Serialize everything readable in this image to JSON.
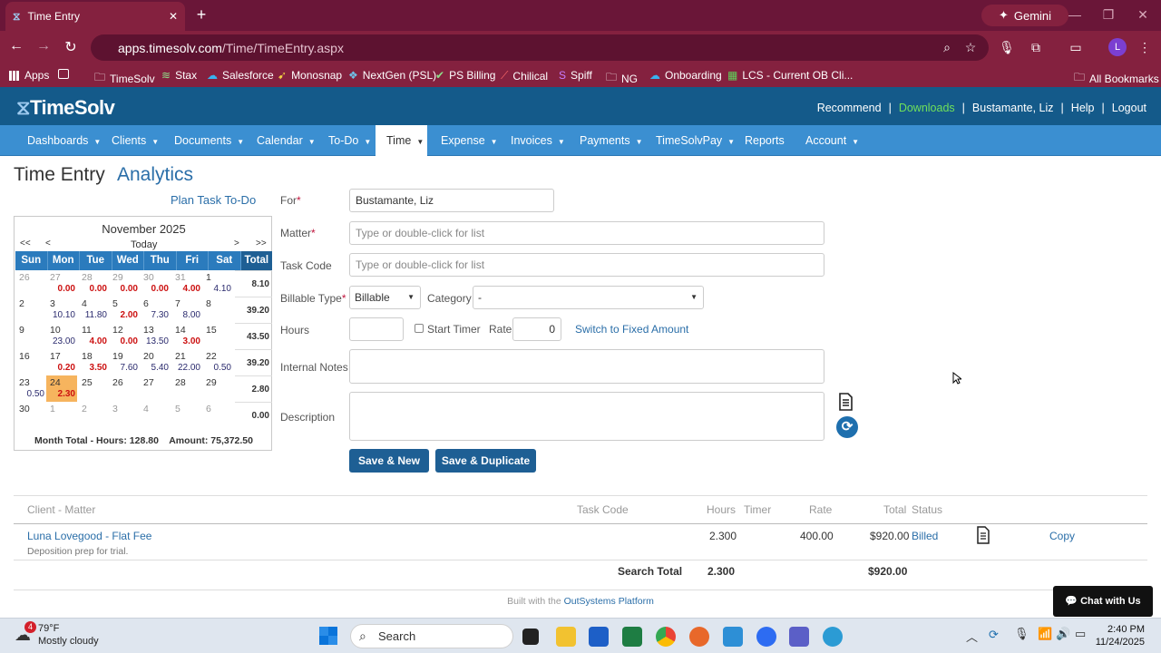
{
  "browser": {
    "tab_title": "Time Entry",
    "gemini_label": "Gemini",
    "url_host": "apps.timesolv.com",
    "url_path": "/Time/TimeEntry.aspx",
    "bookmarks": [
      "Apps",
      "TimeSolv",
      "Stax",
      "Salesforce",
      "Monosnap",
      "NextGen (PSL)",
      "PS Billing",
      "Chilical",
      "Spiff",
      "NG",
      "Onboarding",
      "LCS - Current OB Cli..."
    ],
    "all_bookmarks": "All Bookmarks",
    "avatar_letter": "L"
  },
  "app": {
    "logo": "TimeSolv",
    "top_links": {
      "recommend": "Recommend",
      "downloads": "Downloads",
      "user": "Bustamante, Liz",
      "help": "Help",
      "logout": "Logout"
    },
    "nav": [
      {
        "label": "Dashboards",
        "dropdown": true
      },
      {
        "label": "Clients",
        "dropdown": true
      },
      {
        "label": "Documents",
        "dropdown": true
      },
      {
        "label": "Calendar",
        "dropdown": true
      },
      {
        "label": "To-Do",
        "dropdown": true
      },
      {
        "label": "Time",
        "dropdown": true,
        "active": true
      },
      {
        "label": "Expense",
        "dropdown": true
      },
      {
        "label": "Invoices",
        "dropdown": true
      },
      {
        "label": "Payments",
        "dropdown": true
      },
      {
        "label": "TimeSolvPay",
        "dropdown": true
      },
      {
        "label": "Reports",
        "dropdown": false
      },
      {
        "label": "Account",
        "dropdown": true
      }
    ]
  },
  "page": {
    "title": "Time Entry",
    "analytics": "Analytics",
    "plan_todo": "Plan Task To-Do"
  },
  "calendar": {
    "month": "November 2025",
    "nav": {
      "first": "<<",
      "prev": "<",
      "today": "Today",
      "next": ">",
      "last": ">>"
    },
    "headers": [
      "Sun",
      "Mon",
      "Tue",
      "Wed",
      "Thu",
      "Fri",
      "Sat",
      "Total"
    ],
    "weeks": [
      {
        "days": [
          {
            "d": "26",
            "o": true
          },
          {
            "d": "27",
            "o": true,
            "v": "0.00"
          },
          {
            "d": "28",
            "o": true,
            "v": "0.00"
          },
          {
            "d": "29",
            "o": true,
            "v": "0.00"
          },
          {
            "d": "30",
            "o": true,
            "v": "0.00"
          },
          {
            "d": "31",
            "o": true,
            "v": "4.00"
          },
          {
            "d": "1",
            "v": "4.10"
          }
        ],
        "total": "8.10"
      },
      {
        "days": [
          {
            "d": "2"
          },
          {
            "d": "3",
            "v": "10.10"
          },
          {
            "d": "4",
            "v": "11.80"
          },
          {
            "d": "5",
            "v": "2.00"
          },
          {
            "d": "6",
            "v": "7.30"
          },
          {
            "d": "7",
            "v": "8.00"
          },
          {
            "d": "8"
          }
        ],
        "total": "39.20"
      },
      {
        "days": [
          {
            "d": "9"
          },
          {
            "d": "10",
            "v": "23.00"
          },
          {
            "d": "11",
            "v": "4.00"
          },
          {
            "d": "12",
            "v": "0.00"
          },
          {
            "d": "13",
            "v": "13.50"
          },
          {
            "d": "14",
            "v": "3.00"
          },
          {
            "d": "15"
          }
        ],
        "total": "43.50"
      },
      {
        "days": [
          {
            "d": "16"
          },
          {
            "d": "17",
            "v": "0.20"
          },
          {
            "d": "18",
            "v": "3.50"
          },
          {
            "d": "19",
            "v": "7.60"
          },
          {
            "d": "20",
            "v": "5.40"
          },
          {
            "d": "21",
            "v": "22.00"
          },
          {
            "d": "22",
            "v": "0.50"
          }
        ],
        "total": "39.20"
      },
      {
        "days": [
          {
            "d": "23",
            "v": "0.50"
          },
          {
            "d": "24",
            "v": "2.30",
            "today": true
          },
          {
            "d": "25"
          },
          {
            "d": "26"
          },
          {
            "d": "27"
          },
          {
            "d": "28"
          },
          {
            "d": "29"
          }
        ],
        "total": "2.80"
      },
      {
        "days": [
          {
            "d": "30"
          },
          {
            "d": "1",
            "o": true
          },
          {
            "d": "2",
            "o": true
          },
          {
            "d": "3",
            "o": true
          },
          {
            "d": "4",
            "o": true
          },
          {
            "d": "5",
            "o": true
          },
          {
            "d": "6",
            "o": true
          }
        ],
        "total": "0.00"
      }
    ],
    "month_total": "Month Total - Hours: 128.80    Amount: 75,372.50"
  },
  "form": {
    "for_label": "For",
    "for_value": "Bustamante, Liz",
    "matter_label": "Matter",
    "matter_placeholder": "Type or double-click for list",
    "task_label": "Task Code",
    "task_placeholder": "Type or double-click for list",
    "billable_label": "Billable Type",
    "billable_value": "Billable",
    "category_label": "Category",
    "category_value": "-",
    "hours_label": "Hours",
    "hours_value": "",
    "start_timer": "Start Timer",
    "rate_label": "Rate",
    "rate_value": "0",
    "switch_fixed": "Switch to Fixed Amount",
    "internal_notes_label": "Internal Notes",
    "description_label": "Description",
    "save_new": "Save & New",
    "save_duplicate": "Save & Duplicate"
  },
  "results": {
    "headers": {
      "client": "Client - Matter",
      "task": "Task Code",
      "hours": "Hours",
      "timer": "Timer",
      "rate": "Rate",
      "total": "Total",
      "status": "Status"
    },
    "rows": [
      {
        "client": "Luna Lovegood - Flat Fee",
        "note": "Deposition prep for trial.",
        "hours": "2.300",
        "rate": "400.00",
        "total": "$920.00",
        "status": "Billed",
        "copy": "Copy"
      }
    ],
    "search_total_label": "Search Total",
    "search_total_hours": "2.300",
    "search_total_amount": "$920.00"
  },
  "footer": {
    "built_prefix": "Built with the ",
    "built_link": "OutSystems Platform",
    "chat": "Chat with Us"
  },
  "taskbar": {
    "weather_temp": "79°F",
    "weather_desc": "Mostly cloudy",
    "weather_badge": "4",
    "search": "Search",
    "time": "2:40 PM",
    "date": "11/24/2025"
  },
  "colors": {
    "header": "#145a8a",
    "nav": "#3b8fd1",
    "browser": "#84213f",
    "today": "#f6b45e"
  }
}
